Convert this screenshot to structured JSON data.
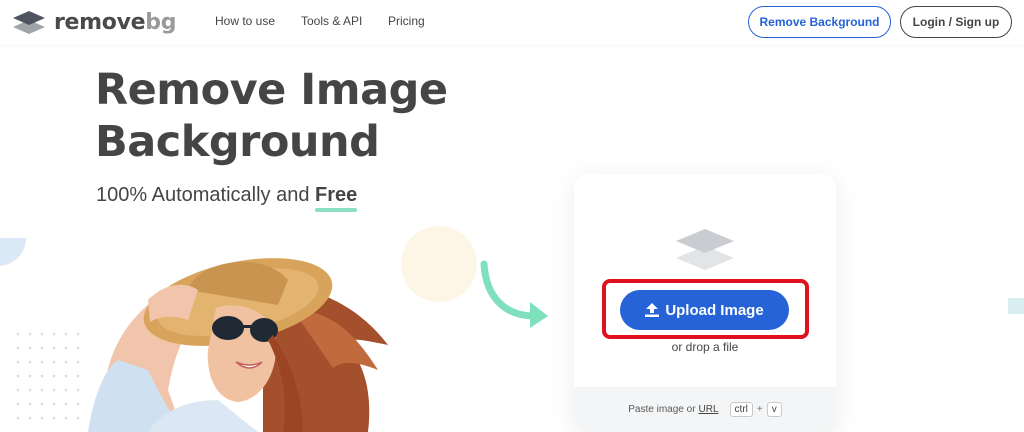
{
  "header": {
    "logo_word1": "remove",
    "logo_word2": "bg",
    "nav": [
      "How to use",
      "Tools & API",
      "Pricing"
    ],
    "cta_remove": "Remove Background",
    "cta_login": "Login / Sign up"
  },
  "hero": {
    "title_line1": "Remove Image",
    "title_line2": "Background",
    "subtitle_prefix": "100% Automatically and ",
    "subtitle_free": "Free"
  },
  "upload": {
    "button_label": "Upload Image",
    "drop_text": "or drop a file",
    "paste_prefix": "Paste image or",
    "paste_url": "URL",
    "key_ctrl": "ctrl",
    "key_plus": "+",
    "key_v": "v"
  },
  "colors": {
    "accent_blue": "#2563d6",
    "highlight_red": "#e0101c",
    "underline_green": "#8bdfc2",
    "text_dark": "#454545"
  },
  "icons": {
    "logo": "stacked-layers-logo-icon",
    "upload": "upload-arrow-icon",
    "layers": "layers-icon",
    "arrow": "curved-arrow-icon"
  }
}
